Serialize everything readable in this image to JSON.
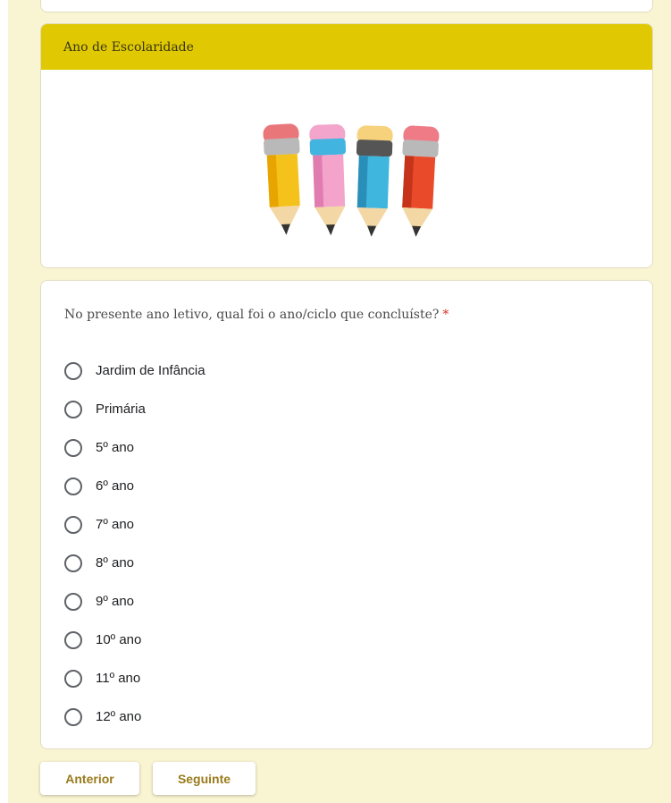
{
  "section": {
    "title": "Ano de Escolaridade",
    "image_name": "colored-pencils-illustration"
  },
  "question": {
    "text": "No presente ano letivo, qual foi o ano/ciclo que concluíste?",
    "required_marker": "*",
    "options": [
      "Jardim de Infância",
      "Primária",
      "5º ano",
      "6º ano",
      "7º ano",
      "8º ano",
      "9º ano",
      "10º ano",
      "11º ano",
      "12º ano"
    ],
    "selected": null
  },
  "navigation": {
    "previous_label": "Anterior",
    "next_label": "Seguinte"
  },
  "colors": {
    "page_background": "#f9f4d2",
    "header_accent": "#e0c902",
    "button_text": "#9a7b1c",
    "required": "#d93025"
  }
}
